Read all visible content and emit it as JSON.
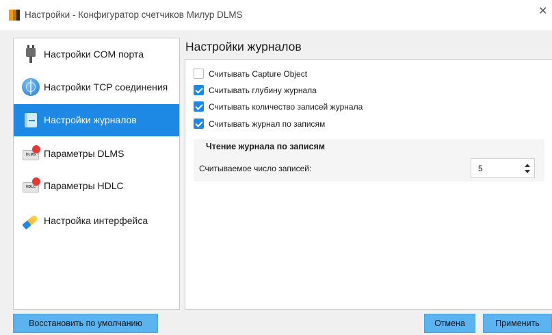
{
  "window": {
    "title": "Настройки - Конфигуратор счетчиков Милур DLMS",
    "close_glyph": "✕"
  },
  "sidebar": {
    "items": [
      {
        "label": "Настройки COM порта",
        "icon": "usb-plug-icon",
        "active": false
      },
      {
        "label": "Настройки TCP соединения",
        "icon": "globe-icon",
        "active": false
      },
      {
        "label": "Настройки журналов",
        "icon": "book-icon",
        "active": true
      },
      {
        "label": "Параметры DLMS",
        "icon": "dlms-chip-icon",
        "icon_text": "DLMS",
        "active": false
      },
      {
        "label": "Параметры HDLC",
        "icon": "hdlc-chip-icon",
        "icon_text": "HDLC",
        "active": false
      },
      {
        "label": "Настройка интерфейса",
        "icon": "wrench-icon",
        "active": false
      }
    ]
  },
  "main": {
    "title": "Настройки журналов",
    "checkboxes": [
      {
        "label": "Считывать Capture Object",
        "checked": false
      },
      {
        "label": "Считывать глубину журнала",
        "checked": true
      },
      {
        "label": "Считывать количество записей журнала",
        "checked": true
      },
      {
        "label": "Считывать журнал по записям",
        "checked": true
      }
    ],
    "group": {
      "title": "Чтение журнала по записям",
      "field_label": "Считываемое число записей:",
      "field_value": "5"
    }
  },
  "footer": {
    "restore_label": "Восстановить по умолчанию",
    "cancel_label": "Отмена",
    "apply_label": "Применить"
  },
  "colors": {
    "accent": "#1e88e5",
    "button": "#5bb3f0"
  }
}
